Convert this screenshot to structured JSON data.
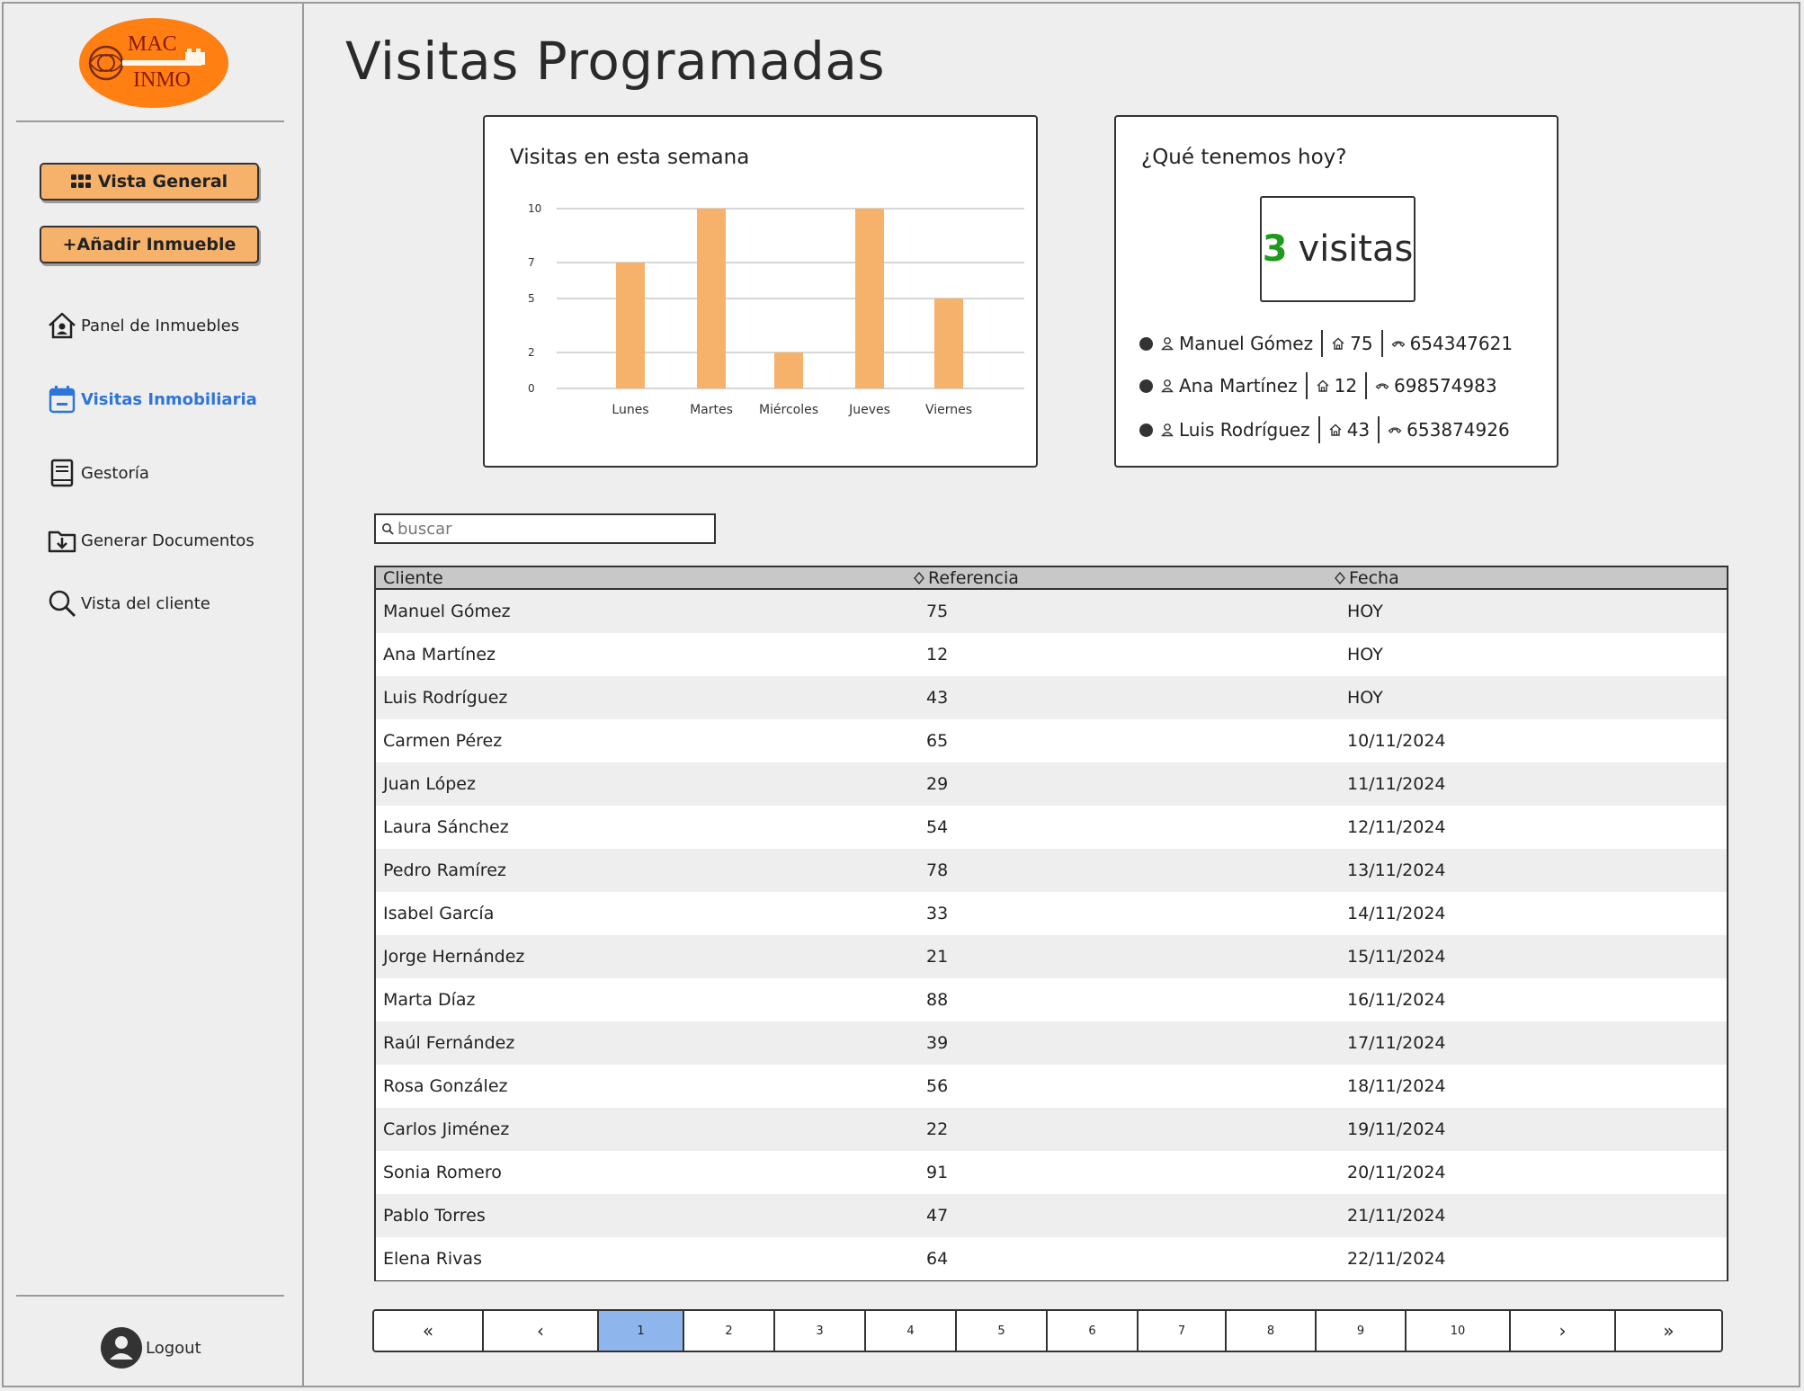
{
  "brand": {
    "line1": "MAC",
    "line2": "INMO",
    "color": "#ff7f12"
  },
  "sidebar": {
    "buttons": [
      {
        "label": "Vista General",
        "icon": "grid-icon"
      },
      {
        "label": "+Añadir Inmueble"
      }
    ],
    "items": [
      {
        "label": "Panel de Inmuebles",
        "icon": "house-user-icon"
      },
      {
        "label": "Visitas Inmobiliaria",
        "icon": "calendar-icon",
        "active": true
      },
      {
        "label": "Gestoría",
        "icon": "book-icon"
      },
      {
        "label": "Generar Documentos",
        "icon": "folder-download-icon"
      },
      {
        "label": "Vista del cliente",
        "icon": "search-icon"
      }
    ],
    "logout": "Logout"
  },
  "page": {
    "title": "Visitas Programadas"
  },
  "chart_data": {
    "type": "bar",
    "title": "Visitas en esta semana",
    "categories": [
      "Lunes",
      "Martes",
      "Miércoles",
      "Jueves",
      "Viernes"
    ],
    "values": [
      7,
      10,
      2,
      10,
      5
    ],
    "yticks": [
      "0",
      "2",
      "5",
      "7",
      "10"
    ],
    "ylim": [
      0,
      10
    ],
    "grid": true,
    "bar_color": "#f6b16a"
  },
  "today": {
    "title": "¿Qué tenemos hoy?",
    "count": "3",
    "count_label": "visitas",
    "visits": [
      {
        "name": "Manuel Gómez",
        "ref": "75",
        "phone": "654347621"
      },
      {
        "name": "Ana Martínez",
        "ref": "12",
        "phone": "698574983"
      },
      {
        "name": "Luis Rodríguez",
        "ref": "43",
        "phone": "653874926"
      }
    ]
  },
  "search": {
    "placeholder": "buscar"
  },
  "table": {
    "columns": [
      "Cliente",
      "Referencia",
      "Fecha"
    ],
    "rows": [
      [
        "Manuel Gómez",
        "75",
        "HOY"
      ],
      [
        "Ana Martínez",
        "12",
        "HOY"
      ],
      [
        "Luis Rodríguez",
        "43",
        "HOY"
      ],
      [
        "Carmen Pérez",
        "65",
        "10/11/2024"
      ],
      [
        "Juan López",
        "29",
        "11/11/2024"
      ],
      [
        "Laura Sánchez",
        "54",
        "12/11/2024"
      ],
      [
        "Pedro Ramírez",
        "78",
        "13/11/2024"
      ],
      [
        "Isabel García",
        "33",
        "14/11/2024"
      ],
      [
        "Jorge Hernández",
        "21",
        "15/11/2024"
      ],
      [
        "Marta Díaz",
        "88",
        "16/11/2024"
      ],
      [
        "Raúl Fernández",
        "39",
        "17/11/2024"
      ],
      [
        "Rosa González",
        "56",
        "18/11/2024"
      ],
      [
        "Carlos Jiménez",
        "22",
        "19/11/2024"
      ],
      [
        "Sonia Romero",
        "91",
        "20/11/2024"
      ],
      [
        "Pablo Torres",
        "47",
        "21/11/2024"
      ],
      [
        "Elena Rivas",
        "64",
        "22/11/2024"
      ]
    ]
  },
  "pagination": {
    "first": "«",
    "prev": "‹",
    "next": "›",
    "last": "»",
    "pages": [
      "1",
      "2",
      "3",
      "4",
      "5",
      "6",
      "7",
      "8",
      "9",
      "10"
    ],
    "current": "1"
  }
}
